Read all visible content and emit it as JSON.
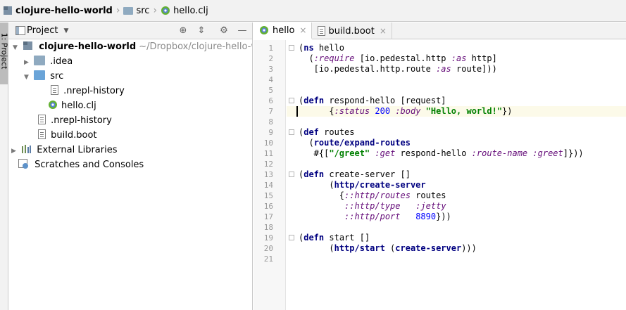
{
  "breadcrumb": {
    "project": "clojure-hello-world",
    "folder": "src",
    "file": "hello.clj"
  },
  "stripe": {
    "label": "1: Project"
  },
  "project_panel": {
    "title": "Project",
    "tree": [
      {
        "label": "clojure-hello-world",
        "hint": "~/Dropbox/clojure-hello-wo"
      },
      {
        "label": ".idea"
      },
      {
        "label": "src"
      },
      {
        "label": ".nrepl-history"
      },
      {
        "label": "hello.clj"
      },
      {
        "label": ".nrepl-history"
      },
      {
        "label": "build.boot"
      },
      {
        "label": "External Libraries"
      },
      {
        "label": "Scratches and Consoles"
      }
    ]
  },
  "editor": {
    "tabs": [
      {
        "label": "hello",
        "close": "×"
      },
      {
        "label": "build.boot",
        "close": "×"
      }
    ],
    "line_numbers": [
      "1",
      "2",
      "3",
      "4",
      "5",
      "6",
      "7",
      "8",
      "9",
      "10",
      "11",
      "12",
      "13",
      "14",
      "15",
      "16",
      "17",
      "18",
      "19",
      "20",
      "21"
    ],
    "code": [
      "(ns hello",
      "  (:require [io.pedestal.http :as http]",
      "   [io.pedestal.http.route :as route]))",
      "",
      "",
      "(defn respond-hello [request]",
      "      {:status 200 :body \"Hello, world!\"})",
      "",
      "(def routes",
      "  (route/expand-routes",
      "   #{[\"/greet\" :get respond-hello :route-name :greet]}))",
      "",
      "(defn create-server []",
      "      (http/create-server",
      "        {::http/routes routes",
      "         ::http/type   :jetty",
      "         ::http/port   8890}))",
      "",
      "(defn start []",
      "      (http/start (create-server)))",
      ""
    ]
  }
}
